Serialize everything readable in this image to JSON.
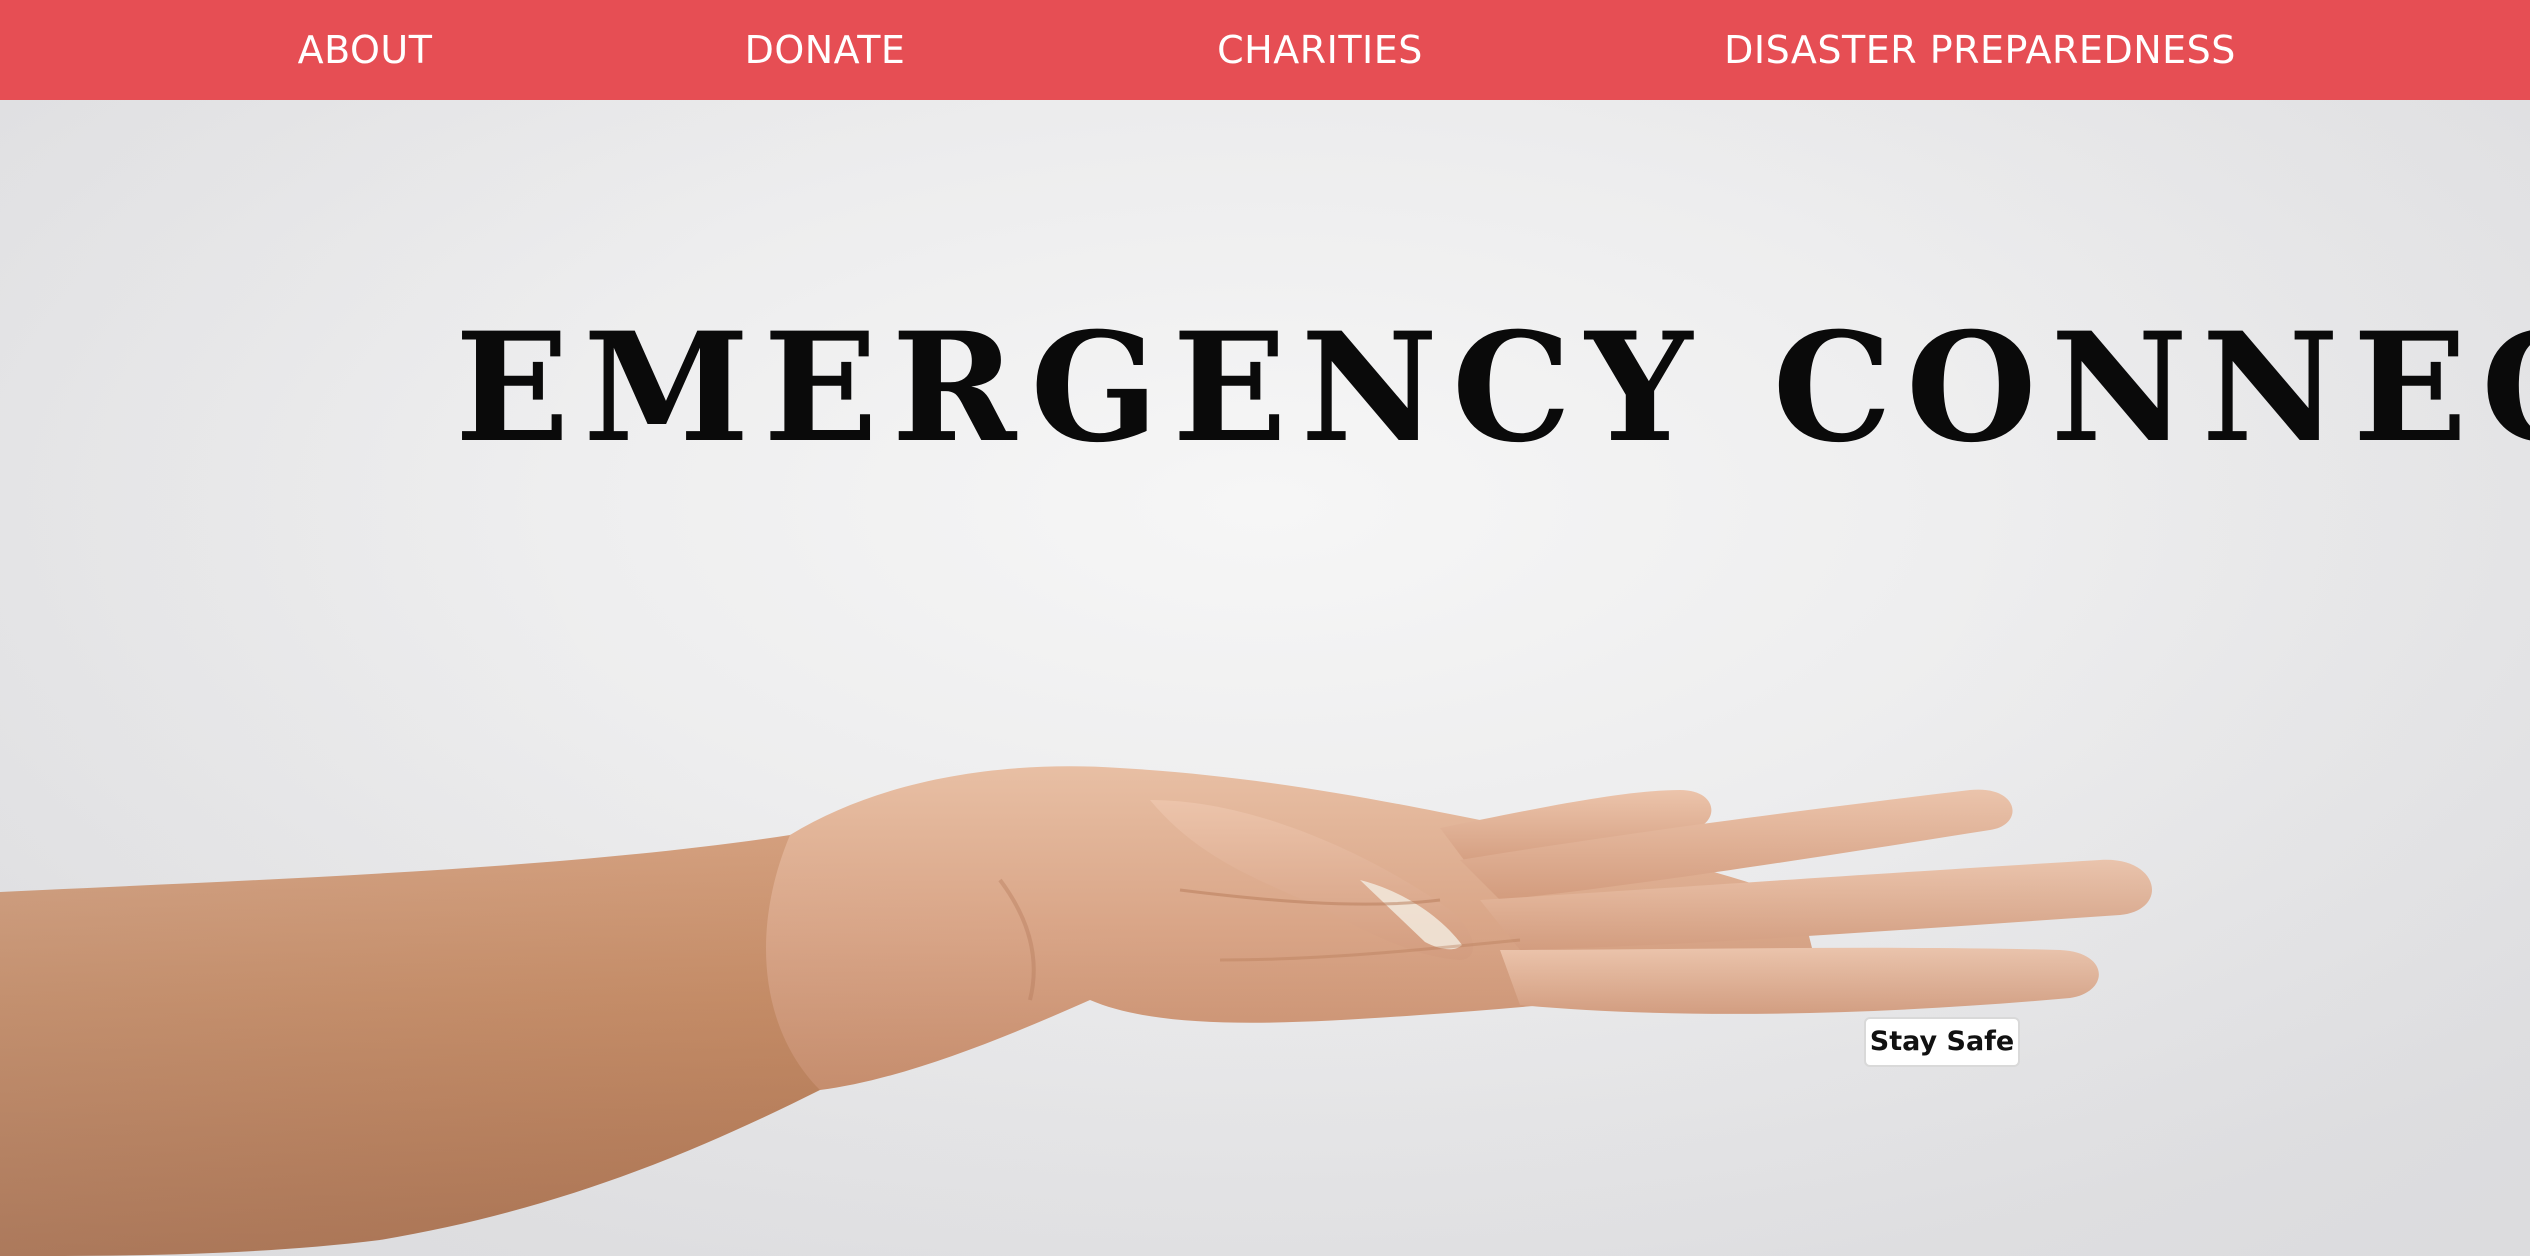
{
  "nav": {
    "items": [
      {
        "label": "ABOUT"
      },
      {
        "label": "DONATE"
      },
      {
        "label": "CHARITIES"
      },
      {
        "label": "DISASTER PREPAREDNESS"
      }
    ],
    "background_color": "#e64e54",
    "text_color": "#ffffff"
  },
  "hero": {
    "title": "EMERGENCY CONNECT",
    "image": "open-hand-photo",
    "cta_label": "Stay Safe"
  }
}
